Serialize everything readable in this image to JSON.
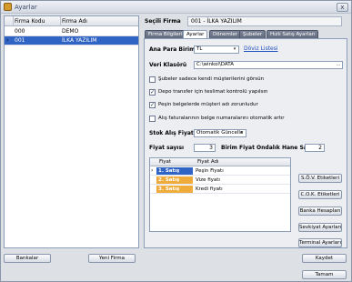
{
  "window": {
    "title": "Ayarlar",
    "close_label": "x"
  },
  "left_grid": {
    "headers": [
      "Firma Kodu",
      "Firma Adı"
    ],
    "rows": [
      {
        "code": "000",
        "name": "DEMO"
      },
      {
        "code": "001",
        "name": "İLKA YAZILIM"
      }
    ],
    "selected_marker": "›"
  },
  "selected_firm": {
    "label": "Seçili Firma",
    "value": "001 - İLKA YAZILIM"
  },
  "tabs": [
    "Firma Bilgileri",
    "Ayarlar",
    "Dönemler",
    "Şubeler",
    "Hızlı Satış Ayarları"
  ],
  "settings": {
    "currency_label": "Ana Para Birimi",
    "currency_value": "TL",
    "currency_link": "Döviz Listesi",
    "data_folder_label": "Veri Klasörü",
    "data_folder_value": "C:\\winkol\\DATA",
    "data_folder_btn": "...",
    "checkboxes": [
      {
        "label": "Şubeler sadece kendi müşterilerini görsün",
        "checked": false
      },
      {
        "label": "Depo transfer için teslimat kontrolü yapılsın",
        "checked": true
      },
      {
        "label": "Peşin belgelerde müşteri adı zorunludur",
        "checked": true
      },
      {
        "label": "Alış faturalarının belge numaralarını otomatik artır",
        "checked": false
      }
    ],
    "check_mark": "✓",
    "stock_price_label": "Stok Alış Fiyatı",
    "stock_price_value": "Otomatik Güncelle",
    "price_count_label": "Fiyat sayısı",
    "price_count_value": "3",
    "decimal_label": "Birim Fiyat Ondalık Hane Sayısı",
    "decimal_value": "2"
  },
  "price_grid": {
    "headers": [
      "Fiyat",
      "Fiyat Adı"
    ],
    "rows": [
      {
        "name": "1. Satış Fiyatı",
        "adi": "Peşin Fiyatı"
      },
      {
        "name": "2. Satış Fiyatı",
        "adi": "Vize fiyatı"
      },
      {
        "name": "3. Satış Fiyatı",
        "adi": "Kredi fiyatı"
      }
    ]
  },
  "side_buttons": [
    "S.Ö.V. Etiketleri",
    "C.O.K. Etiketleri",
    "Banka Hesapları",
    "Sevkiyat Ayarları",
    "Terminal Ayarları"
  ],
  "footer": {
    "bankalar": "Bankalar",
    "yeni_firma": "Yeni Firma",
    "kaydet": "Kaydet",
    "tamam": "Tamam"
  },
  "combo_arrow": "▾"
}
